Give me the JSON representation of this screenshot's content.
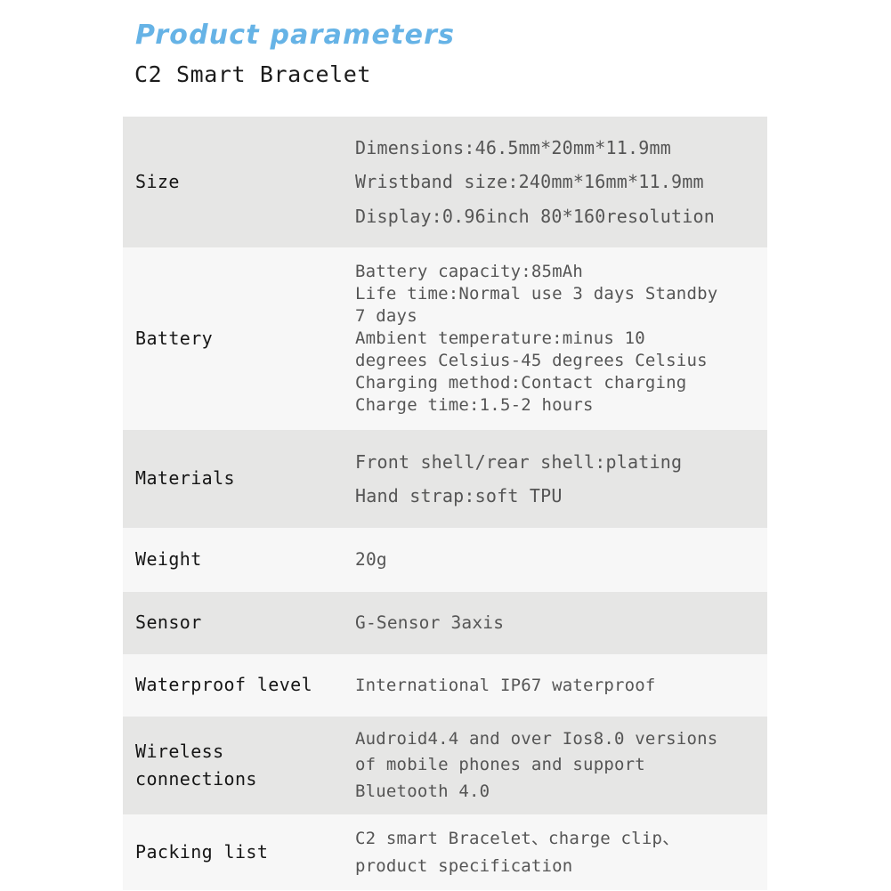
{
  "header": {
    "title": "Product parameters",
    "subtitle": "C2 Smart Bracelet",
    "title_color": "#66b3e6",
    "subtitle_color": "#1c1c1c"
  },
  "table": {
    "shade_dark": "#e6e6e5",
    "shade_light": "#f7f7f7",
    "rows": [
      {
        "label": "Size",
        "label_lines": [
          "Size"
        ],
        "value_lines": [
          "Dimensions:46.5mm*20mm*11.9mm",
          "Wristband size:240mm*16mm*11.9mm",
          "Display:0.96inch 80*160resolution"
        ]
      },
      {
        "label": "Battery",
        "label_lines": [
          "Battery"
        ],
        "value_lines": [
          "Battery capacity:85mAh",
          "Life time:Normal use 3 days Standby",
          "7 days",
          "Ambient temperature:minus 10",
          "degrees Celsius-45 degrees Celsius",
          "Charging method:Contact charging",
          "Charge time:1.5-2 hours"
        ]
      },
      {
        "label": "Materials",
        "label_lines": [
          "Materials"
        ],
        "value_lines": [
          "Front shell/rear shell:plating",
          "Hand strap:soft TPU"
        ]
      },
      {
        "label": "Weight",
        "label_lines": [
          "Weight"
        ],
        "value_lines": [
          "20g"
        ]
      },
      {
        "label": "Sensor",
        "label_lines": [
          "Sensor"
        ],
        "value_lines": [
          "G-Sensor 3axis"
        ]
      },
      {
        "label": "Waterproof level",
        "label_lines": [
          "Waterproof level"
        ],
        "value_lines": [
          "International IP67 waterproof"
        ]
      },
      {
        "label": "Wireless connections",
        "label_lines": [
          "Wireless",
          "connections"
        ],
        "value_lines": [
          "Audroid4.4 and over Ios8.0 versions",
          "of mobile phones and support",
          "Bluetooth 4.0"
        ]
      },
      {
        "label": "Packing list",
        "label_lines": [
          "Packing list"
        ],
        "value_lines": [
          "C2 smart Bracelet、charge clip、",
          "product specification"
        ]
      }
    ]
  }
}
